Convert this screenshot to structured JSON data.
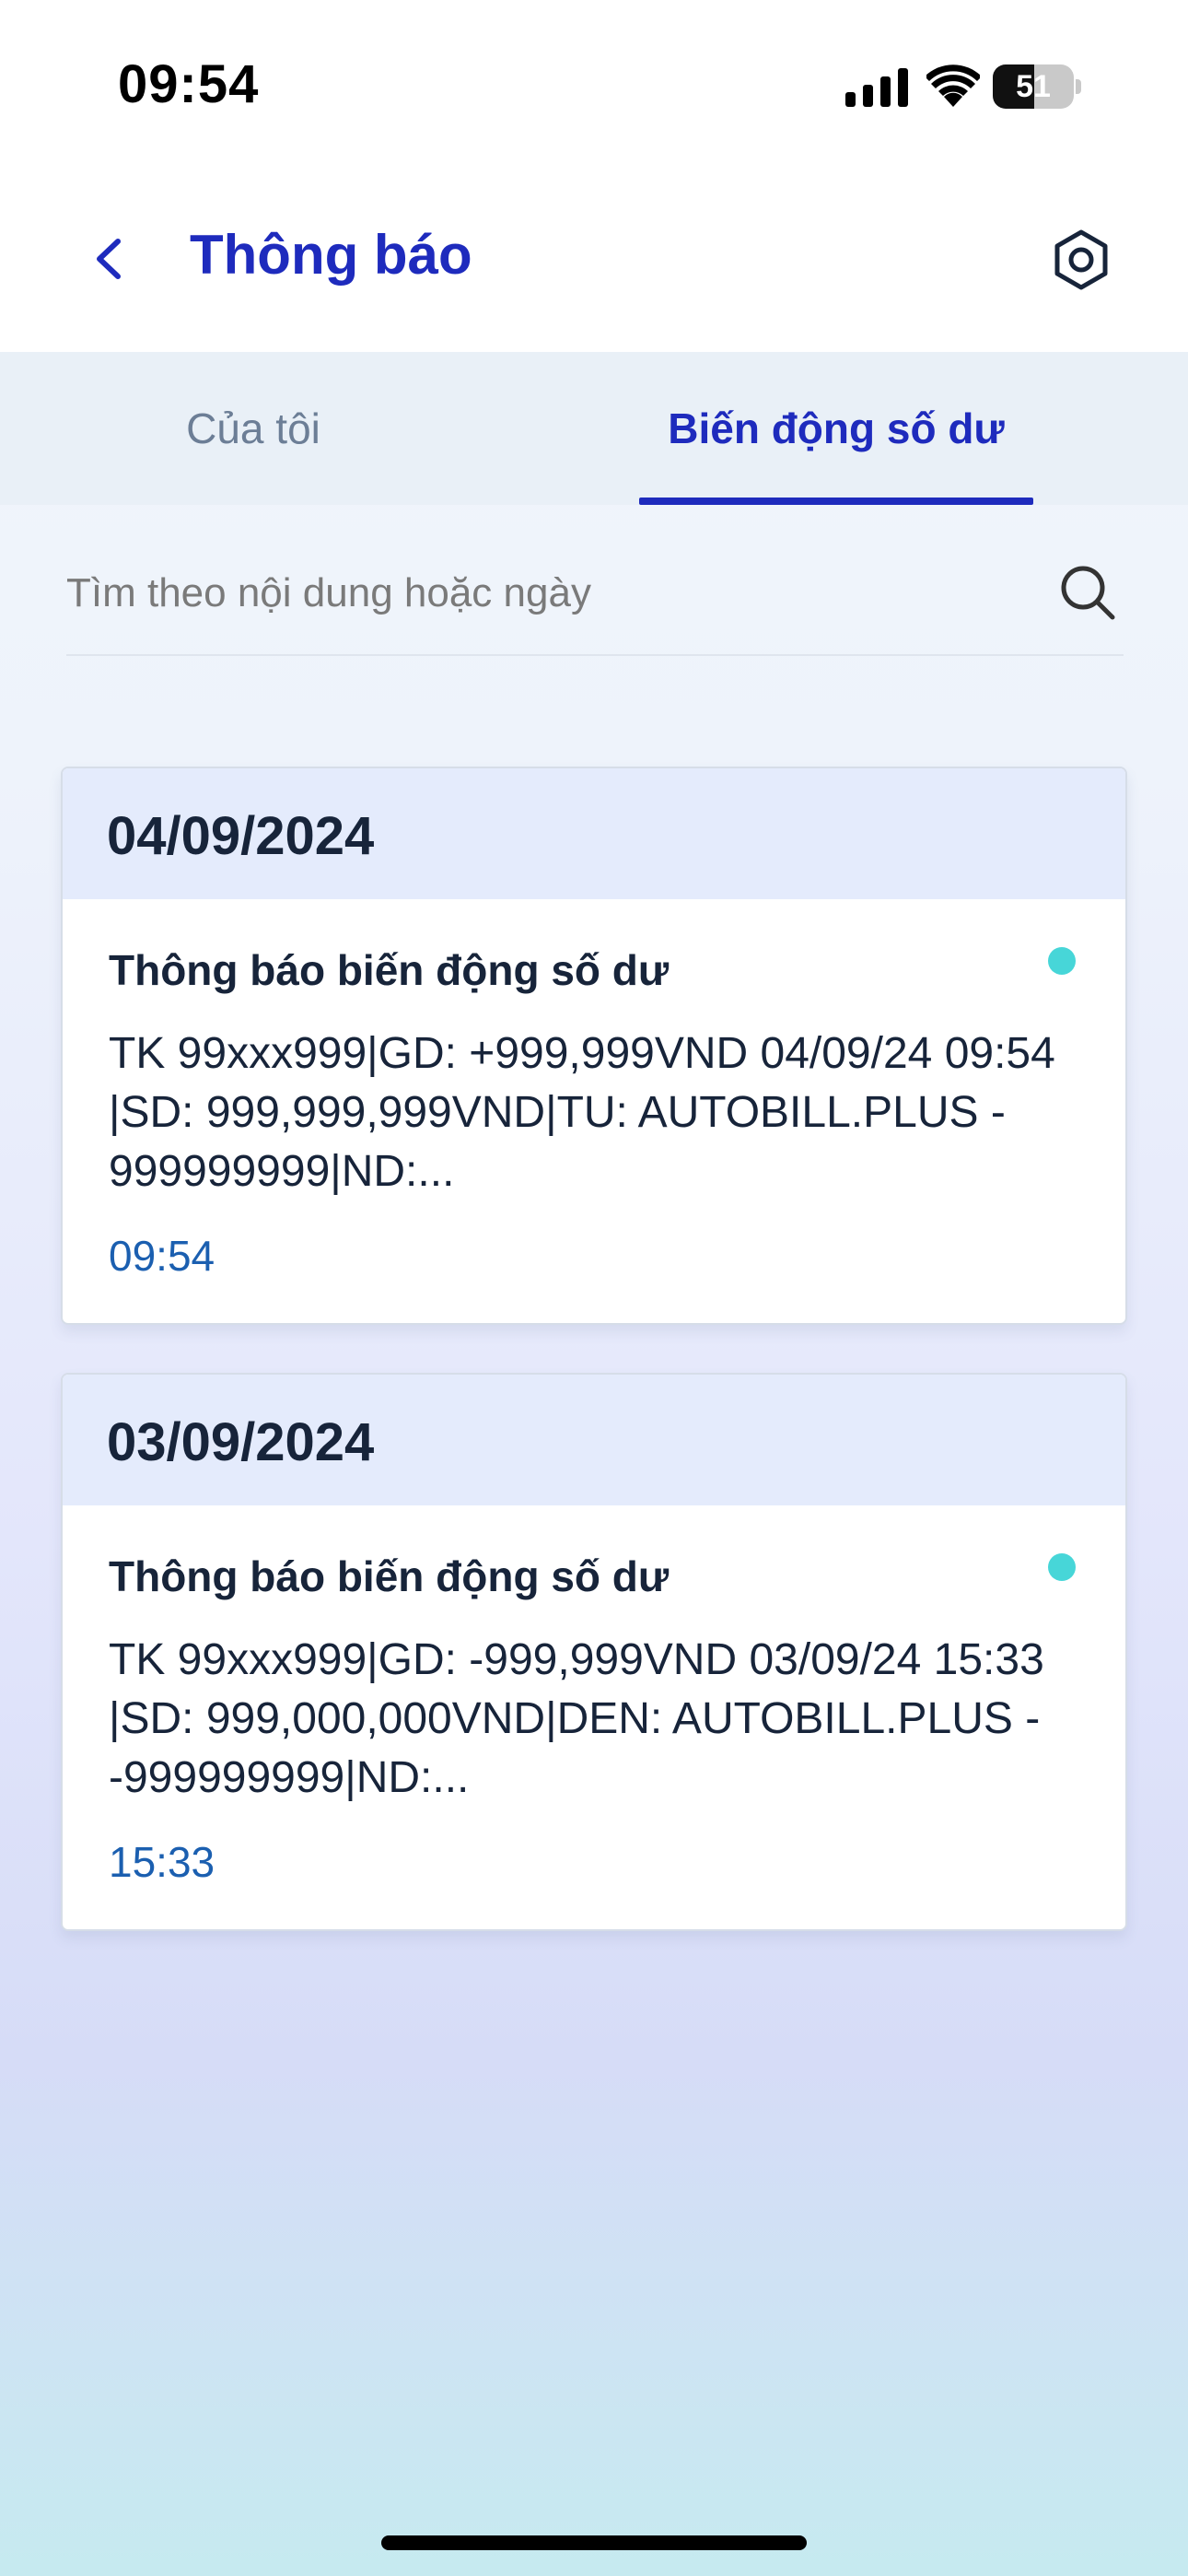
{
  "status_bar": {
    "time": "09:54",
    "battery_level": "51"
  },
  "header": {
    "title": "Thông báo",
    "back_icon": "chevron-left-icon",
    "settings_icon": "gear-icon"
  },
  "tabs": [
    {
      "label": "Của tôi",
      "active": false
    },
    {
      "label": "Biến động số dư",
      "active": true
    }
  ],
  "search": {
    "placeholder": "Tìm theo nội dung hoặc ngày",
    "icon": "search-icon"
  },
  "groups": [
    {
      "date": "04/09/2024",
      "items": [
        {
          "title": "Thông báo biến động số dư",
          "body": "TK 99xxx999|GD: +999,999VND 04/09/24 09:54 |SD: 999,999,999VND|TU: AUTOBILL.PLUS - 999999999|ND:...",
          "time": "09:54",
          "unread": true
        }
      ]
    },
    {
      "date": "03/09/2024",
      "items": [
        {
          "title": "Thông báo biến động số dư",
          "body": "TK 99xxx999|GD: -999,999VND 03/09/24 15:33 |SD: 999,000,000VND|DEN: AUTOBILL.PLUS - -999999999|ND:...",
          "time": "15:33",
          "unread": true
        }
      ]
    }
  ],
  "colors": {
    "accent": "#1e2bbd",
    "unread_dot": "#47d6d8",
    "time_text": "#1b5fb0",
    "card_header": "#e4ebfc"
  }
}
